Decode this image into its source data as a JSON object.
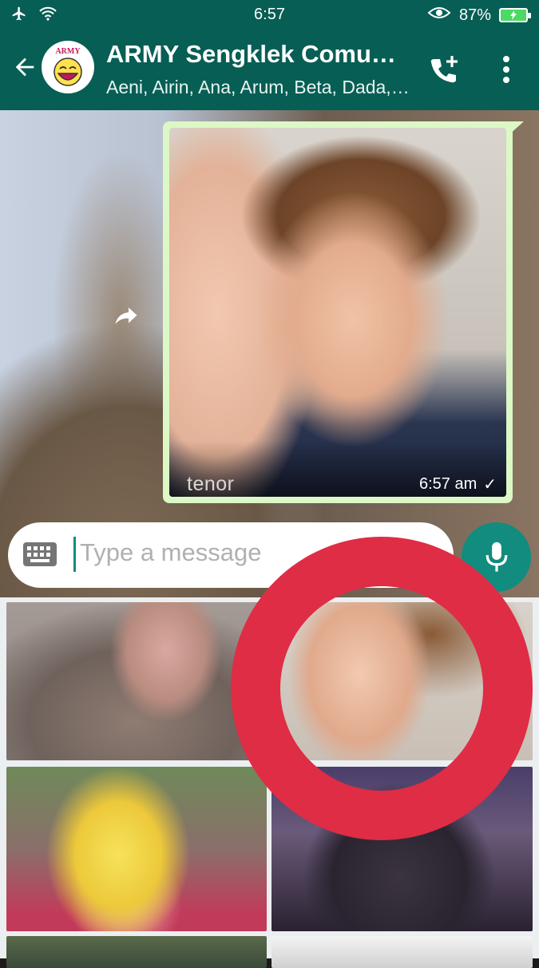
{
  "status_bar": {
    "time": "6:57",
    "battery_percent": "87%",
    "icons": [
      "airplane-icon",
      "wifi-icon",
      "eye-icon",
      "battery-charging-icon"
    ]
  },
  "header": {
    "title": "ARMY Sengklek Comu…",
    "subtitle": "Aeni, Airin, Ana, Arum, Beta, Dada,…",
    "avatar_text": "ARMY"
  },
  "message": {
    "watermark": "tenor",
    "time": "6:57 am",
    "status": "✓"
  },
  "composer": {
    "placeholder": "Type a message"
  },
  "colors": {
    "header": "#075e54",
    "accent": "#128c7e",
    "bubble": "#dcf8c6",
    "annotation_ring": "#de2d45"
  }
}
